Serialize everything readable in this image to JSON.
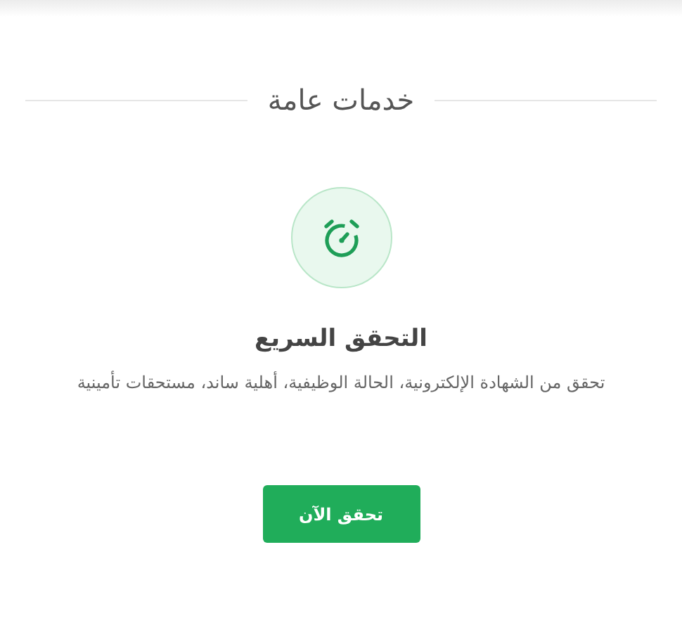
{
  "section_title": "خدمات عامة",
  "card": {
    "title": "التحقق السريع",
    "description": "تحقق من الشهادة الإلكترونية، الحالة الوظيفية، أهلية ساند، مستحقات تأمينية",
    "button": "تحقق الآن"
  }
}
